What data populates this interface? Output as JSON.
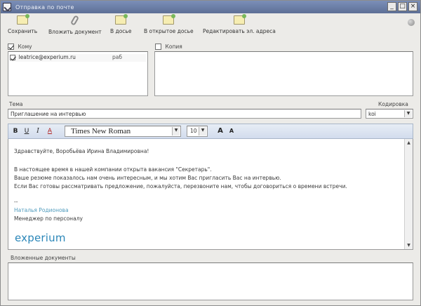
{
  "window": {
    "title": "Отправка по почте",
    "buttons": [
      "_",
      "□",
      "×"
    ]
  },
  "toolbar": {
    "items": [
      {
        "label": "Сохранить",
        "icon": "save-icon"
      },
      {
        "label": "Вложить документ",
        "icon": "paperclip-icon"
      },
      {
        "label": "В досье",
        "icon": "folder-icon"
      },
      {
        "label": "В открытое досье",
        "icon": "folder-open-icon"
      },
      {
        "label": "Редактировать эл. адреса",
        "icon": "address-book-icon"
      }
    ]
  },
  "to_panel": {
    "label": "Кому",
    "checked": true,
    "recipient_email": "leatrice@experium.ru",
    "recipient_type": "раб"
  },
  "copy_panel": {
    "label": "Копия",
    "checked": false
  },
  "subject": {
    "label": "Тема",
    "value": "Приглашение на интервью"
  },
  "encoding": {
    "label": "Кодировка",
    "value": "koi"
  },
  "format_toolbar": {
    "bold": "B",
    "underline": "U",
    "italic": "I",
    "color": "A",
    "font_name": "Times New Roman",
    "font_size": "10",
    "grow": "A",
    "shrink": "A"
  },
  "message": {
    "greeting": "Здравствуйте, Воробьёва Ирина Владимировна!",
    "line1": "В настоящее время в нашей компании открыта вакансия \"Секретарь\".",
    "line2": "Ваше резюме показалось нам очень интересным, и мы хотим Вас пригласить Вас на интервью.",
    "line3": "Если Вас готовы рассматривать предложение, пожалуйста, перезвоните нам, чтобы договориться о времени встречи.",
    "separator": "--",
    "signature_name": "Наталья Родионова",
    "signature_title": "Менеджер по персоналу",
    "logo": "experium"
  },
  "attachments": {
    "label": "Вложенные документы"
  }
}
